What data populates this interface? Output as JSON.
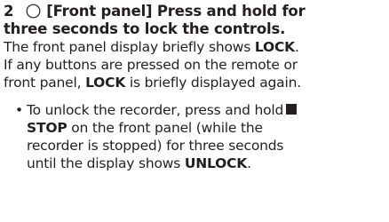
{
  "step": {
    "number": "2",
    "icon": "circle-button-icon",
    "line1": "[Front panel] Press and hold for",
    "line2": "three seconds to lock the controls."
  },
  "paragraph": {
    "line1_text": "The front panel display briefly shows ",
    "line1_bold": "LOCK",
    "line1_end": ".",
    "line2": "If any buttons are pressed on the remote or",
    "line3_text": "front panel, ",
    "line3_bold": "LOCK",
    "line3_end": " is briefly displayed again."
  },
  "bullet": {
    "symbol": "•",
    "line1": "To unlock the recorder, press and hold",
    "stop_icon": "stop-square-icon",
    "line2_bold": "STOP",
    "line2_text": " on the front panel (while the",
    "line3": "recorder is stopped) for three seconds",
    "line4_text": "until the display shows ",
    "line4_bold": "UNLOCK",
    "line4_end": "."
  }
}
